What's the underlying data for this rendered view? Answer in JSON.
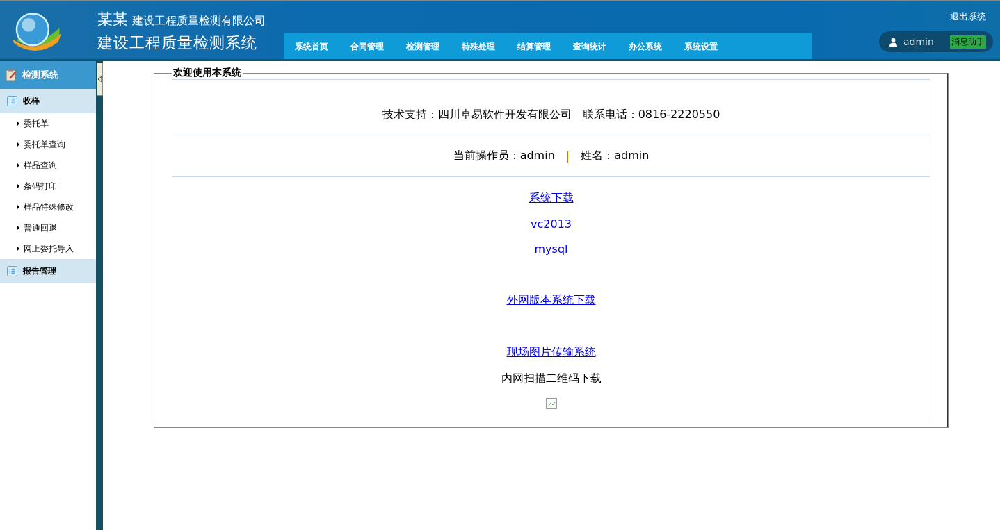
{
  "header": {
    "company_prefix": "某某",
    "company": "建设工程质量检测有限公司",
    "system_title": "建设工程质量检测系统",
    "logout": "退出系统",
    "user": "admin",
    "assistant": "消息助手"
  },
  "nav": [
    "系统首页",
    "合同管理",
    "检测管理",
    "特殊处理",
    "结算管理",
    "查询统计",
    "办公系统",
    "系统设置"
  ],
  "sidebar": {
    "title": "检测系统",
    "groups": [
      {
        "label": "收样",
        "items": [
          "委托单",
          "委托单查询",
          "样品查询",
          "条码打印",
          "样品特殊修改",
          "普通回退",
          "网上委托导入"
        ]
      },
      {
        "label": "报告管理"
      }
    ]
  },
  "welcome": {
    "legend": "欢迎使用本系统",
    "support": "技术支持：四川卓易软件开发有限公司　联系电话：0816-2220550",
    "operator": "当前操作员：admin",
    "separator": "|",
    "name": "姓名：admin",
    "links": [
      {
        "kind": "link",
        "text": "系统下载"
      },
      {
        "kind": "link",
        "text": "vc2013"
      },
      {
        "kind": "link",
        "text": "mysql"
      },
      {
        "kind": "gap"
      },
      {
        "kind": "link",
        "text": "外网版本系统下载"
      },
      {
        "kind": "gap"
      },
      {
        "kind": "link",
        "text": "现场图片传输系统"
      },
      {
        "kind": "text",
        "text": "内网扫描二维码下载"
      },
      {
        "kind": "image"
      }
    ]
  }
}
